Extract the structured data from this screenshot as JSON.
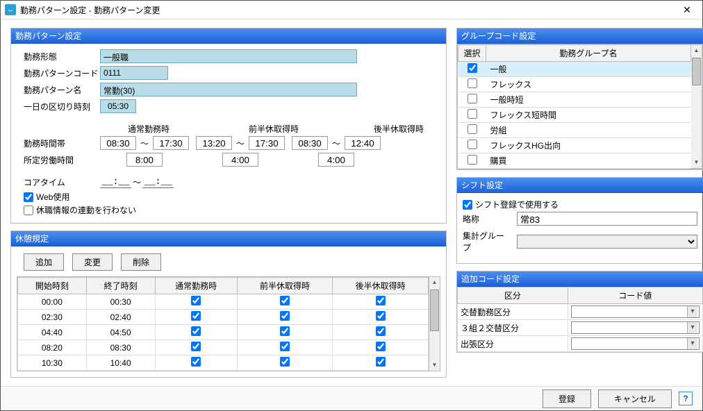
{
  "window": {
    "title": "勤務パターン設定 - 勤務パターン変更"
  },
  "pattern": {
    "header": "勤務パターン設定",
    "labels": {
      "form": "勤務形態",
      "code": "勤務パターンコード",
      "name": "勤務パターン名",
      "daycut": "一日の区切り時刻",
      "band": "勤務時間帯",
      "std": "所定労働時間",
      "core": "コアタイム",
      "web": "Web使用",
      "noleave": "休職情報の連動を行わない"
    },
    "form": "一般職",
    "code": "0111",
    "name": "常勤(30)",
    "daycut": "05:30",
    "cols": {
      "normal": "通常勤務時",
      "firsthalf": "前半休取得時",
      "secondhalf": "後半休取得時"
    },
    "band": {
      "normal": {
        "s": "08:30",
        "e": "17:30"
      },
      "firsthalf": {
        "s": "13:20",
        "e": "17:30"
      },
      "secondhalf": {
        "s": "08:30",
        "e": "12:40"
      }
    },
    "std": {
      "normal": "8:00",
      "firsthalf": "4:00",
      "secondhalf": "4:00"
    },
    "core": {
      "s": "__:__",
      "e": "__:__"
    },
    "web_checked": true,
    "noleave_checked": false
  },
  "rest": {
    "header": "休憩規定",
    "buttons": {
      "add": "追加",
      "edit": "変更",
      "del": "削除"
    },
    "cols": {
      "start": "開始時刻",
      "end": "終了時刻",
      "normal": "通常勤務時",
      "firsthalf": "前半休取得時",
      "secondhalf": "後半休取得時"
    },
    "rows": [
      {
        "start": "00:00",
        "end": "00:30",
        "n": true,
        "f": true,
        "s": true
      },
      {
        "start": "02:30",
        "end": "02:40",
        "n": true,
        "f": true,
        "s": true
      },
      {
        "start": "04:40",
        "end": "04:50",
        "n": true,
        "f": true,
        "s": true
      },
      {
        "start": "08:20",
        "end": "08:30",
        "n": true,
        "f": true,
        "s": true
      },
      {
        "start": "10:30",
        "end": "10:40",
        "n": true,
        "f": true,
        "s": true
      }
    ]
  },
  "group": {
    "header": "グループコード設定",
    "cols": {
      "sel": "選択",
      "name": "勤務グループ名"
    },
    "rows": [
      {
        "sel": true,
        "name": "一般",
        "highlighted": true
      },
      {
        "sel": false,
        "name": "フレックス"
      },
      {
        "sel": false,
        "name": "一般時短"
      },
      {
        "sel": false,
        "name": "フレックス短時間"
      },
      {
        "sel": false,
        "name": "労組"
      },
      {
        "sel": false,
        "name": "フレックスHG出向"
      },
      {
        "sel": false,
        "name": "購買"
      }
    ]
  },
  "shift": {
    "header": "シフト設定",
    "use_label": "シフト登録で使用する",
    "use_checked": true,
    "abbr_label": "略称",
    "abbr": "常83",
    "agg_label": "集計グループ",
    "agg": ""
  },
  "addcode": {
    "header": "追加コード設定",
    "cols": {
      "kind": "区分",
      "val": "コード値"
    },
    "rows": [
      {
        "kind": "交替勤務区分",
        "val": ""
      },
      {
        "kind": "３組２交替区分",
        "val": ""
      },
      {
        "kind": "出張区分",
        "val": ""
      }
    ]
  },
  "footer": {
    "ok": "登録",
    "cancel": "キャンセル"
  }
}
